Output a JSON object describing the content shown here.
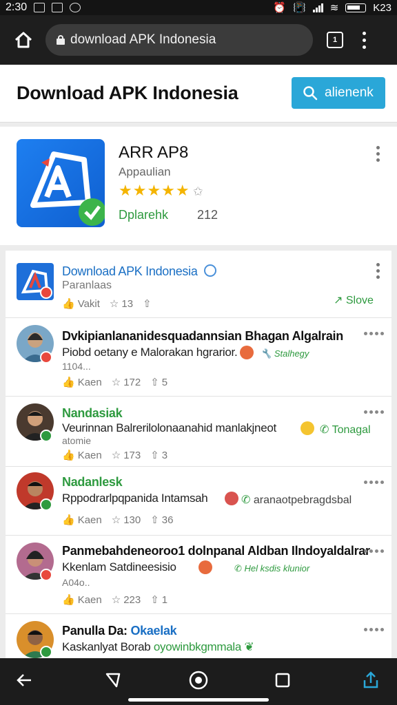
{
  "status_bar": {
    "time": "2:30",
    "battery_text": "K23"
  },
  "browser": {
    "url": "download APK Indonesia",
    "tab_count": "1"
  },
  "header": {
    "title": "Download APK Indonesia",
    "search_label": "alienenk"
  },
  "app": {
    "name": "ARR AP8",
    "category": "Appaulian",
    "rating_stars": "★★★★★",
    "downloads_label": "Dplarehk",
    "size": "212",
    "colors": {
      "icon_bg": "#1e7ff0",
      "accent_green": "#2e9a3f"
    }
  },
  "feed": [
    {
      "title": "Download APK Indonesia",
      "subtitle": "Paranlaas",
      "action": "Slove",
      "stats": [
        "Vakit",
        "13",
        ""
      ]
    },
    {
      "title": "Dvkipianlananidesquadannsian Bhagan Algalrain",
      "text": "Piobd oetany e Malorakan hgrarior.",
      "tag": "Stalhegy",
      "sub": "1104...",
      "stats": [
        "Kaen",
        "172",
        "5"
      ]
    },
    {
      "title": "Nandasiak",
      "text": "Veurinnan Balrerilolonaanahid manlakjneot",
      "tag": "Tonagal",
      "sub": "atomie",
      "stats": [
        "Kaen",
        "173",
        "3"
      ]
    },
    {
      "title": "Nadanlesk",
      "text": "Rppodrarlpqpanida Intamsah",
      "tag": "aranaotpebragdsbal",
      "stats": [
        "Kaen",
        "130",
        "36"
      ]
    },
    {
      "title": "Panmebahdeneoroo1 dolnpanal Aldban Ilndoyaldalrar",
      "text": "Kkenlam Satdineesisio",
      "tag": "Hel ksdis klunior",
      "sub": "A04o..",
      "stats": [
        "Kaen",
        "223",
        "1"
      ]
    },
    {
      "title": "Panulla Da:",
      "title_link": "Okaelak",
      "text": "Kaskanlyat Borab",
      "tag": "oyowinbkgmmala"
    }
  ]
}
